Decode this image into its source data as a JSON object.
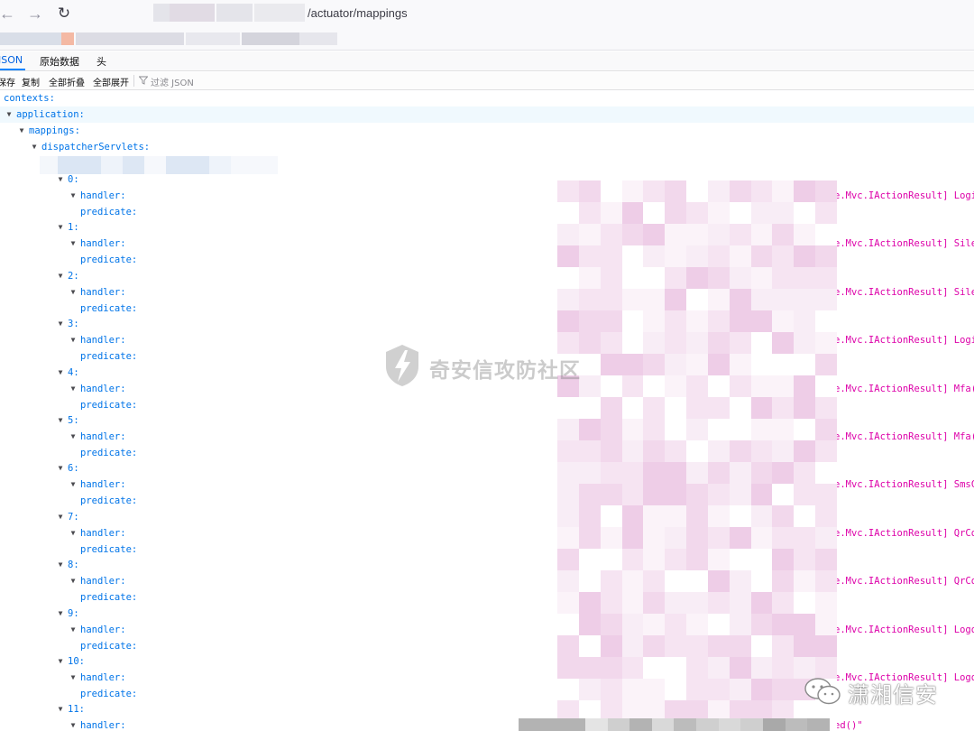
{
  "browser": {
    "url_path": "/actuator/mappings",
    "back_icon": "arrow-left-icon",
    "forward_icon": "arrow-right-icon",
    "reload_icon": "reload-icon"
  },
  "viewer": {
    "tabs": [
      "JSON",
      "原始数据",
      "头"
    ],
    "active_tab": "JSON",
    "toolbar": {
      "save": "保存",
      "copy": "复制",
      "collapse_all": "全部折叠",
      "expand_all": "全部展开",
      "filter_placeholder": "过滤 JSON"
    },
    "colors": {
      "key": "#0074e8",
      "string": "#dd00a9",
      "accent": "#0a84ff"
    }
  },
  "tree": {
    "contexts": "contexts:",
    "application": "application:",
    "mappings": "mappings:",
    "dispatcherServlets": "dispatcherServlets:",
    "handler_key": "handler:",
    "predicate_key": "predicate:",
    "entries": [
      {
        "index": "0:",
        "handler_visible": "e.Mvc.IActionResult] Login("
      },
      {
        "index": "1:",
        "handler_visible": "e.Mvc.IActionResult] Silent"
      },
      {
        "index": "2:",
        "handler_visible": "e.Mvc.IActionResult] Silent"
      },
      {
        "index": "3:",
        "handler_visible": "e.Mvc.IActionResult] Login("
      },
      {
        "index": "4:",
        "handler_visible": "e.Mvc.IActionResult] Mfa(Bo"
      },
      {
        "index": "5:",
        "handler_visible": "e.Mvc.IActionResult] Mfa(eW"
      },
      {
        "index": "6:",
        "handler_visible": "e.Mvc.IActionResult] SmsCod"
      },
      {
        "index": "7:",
        "handler_visible": "e.Mvc.IActionResult] QrCode"
      },
      {
        "index": "8:",
        "handler_visible": "e.Mvc.IActionResult] QrCode"
      },
      {
        "index": "9:",
        "handler_visible": "e.Mvc.IActionResult] Logout"
      },
      {
        "index": "10:",
        "handler_visible": "e.Mvc.IActionResult] Logout"
      },
      {
        "index": "11:",
        "handler_visible": "ed()\""
      }
    ]
  },
  "watermarks": {
    "center": "奇安信攻防社区",
    "corner": "潇湘信安"
  }
}
